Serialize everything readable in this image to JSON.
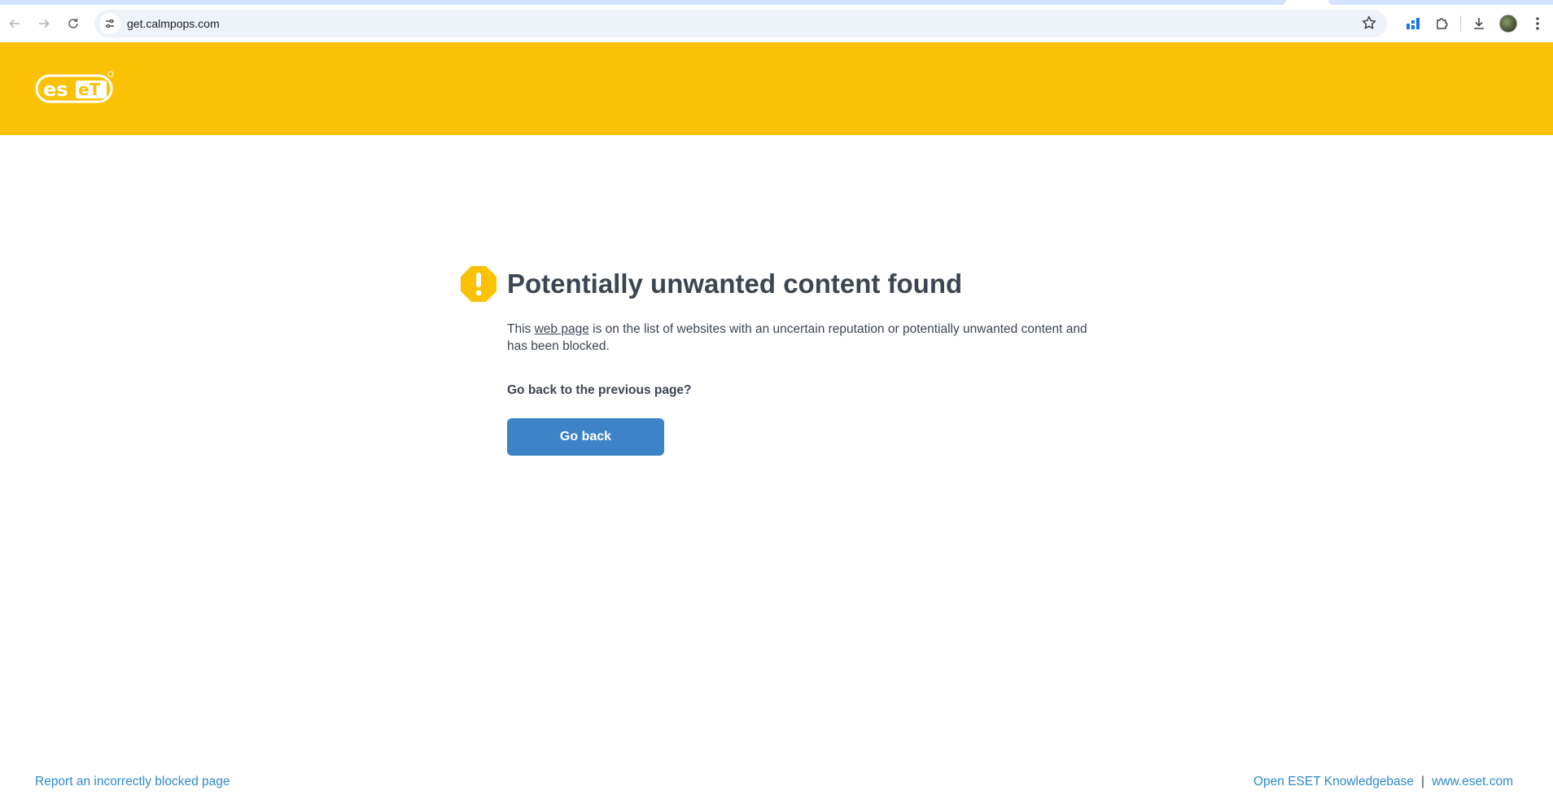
{
  "browser": {
    "url": "get.calmpops.com"
  },
  "page": {
    "title": "Potentially unwanted content found",
    "desc_pre": "This ",
    "desc_link": "web page",
    "desc_post": " is on the list of websites with an uncertain reputation or potentially unwanted content and has been blocked.",
    "question": "Go back to the previous page?",
    "go_back_label": "Go back",
    "brand_color": "#fbc104",
    "button_color": "#3e83c8"
  },
  "footer": {
    "report_link": "Report an incorrectly blocked page",
    "kb_link": "Open ESET Knowledgebase",
    "separator": "|",
    "site_link": "www.eset.com"
  },
  "logo": {
    "text": "eset"
  }
}
